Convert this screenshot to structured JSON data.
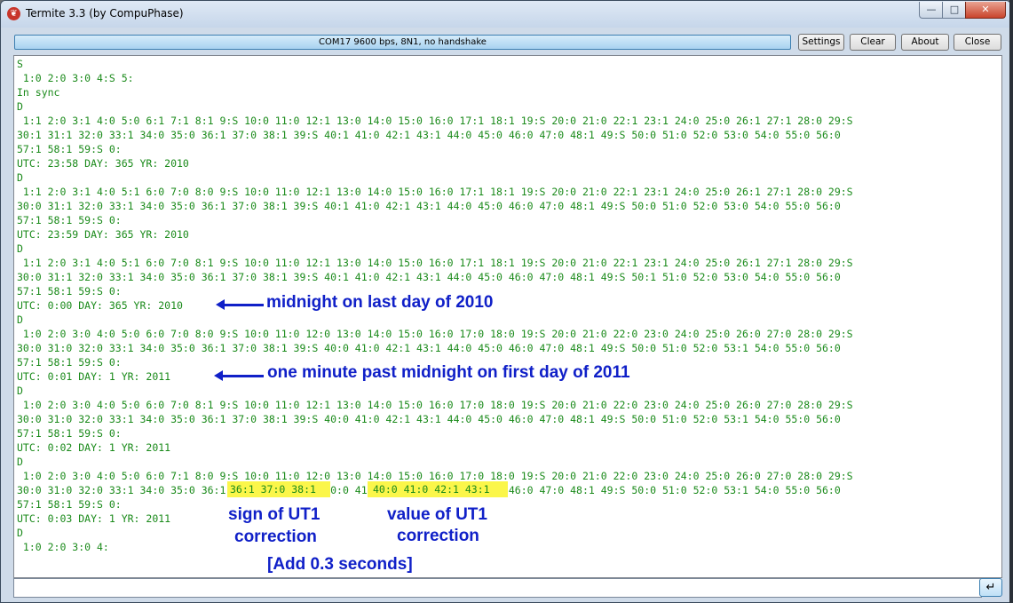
{
  "window": {
    "title": "Termite 3.3 (by CompuPhase)",
    "controls": {
      "minimize": "—",
      "maximize": "□",
      "close": "✕"
    }
  },
  "toolbar": {
    "status": "COM17 9600 bps, 8N1, no handshake",
    "settings": "Settings",
    "clear": "Clear",
    "about": "About",
    "close": "Close"
  },
  "terminal": {
    "lines": [
      "S",
      " 1:0 2:0 3:0 4:S 5:",
      "In sync",
      "D",
      " 1:1 2:0 3:1 4:0 5:0 6:1 7:1 8:1 9:S 10:0 11:0 12:1 13:0 14:0 15:0 16:0 17:1 18:1 19:S 20:0 21:0 22:1 23:1 24:0 25:0 26:1 27:1 28:0 29:S",
      "30:1 31:1 32:0 33:1 34:0 35:0 36:1 37:0 38:1 39:S 40:1 41:0 42:1 43:1 44:0 45:0 46:0 47:0 48:1 49:S 50:0 51:0 52:0 53:0 54:0 55:0 56:0",
      "57:1 58:1 59:S 0:",
      "UTC: 23:58 DAY: 365 YR: 2010",
      "D",
      " 1:1 2:0 3:1 4:0 5:1 6:0 7:0 8:0 9:S 10:0 11:0 12:1 13:0 14:0 15:0 16:0 17:1 18:1 19:S 20:0 21:0 22:1 23:1 24:0 25:0 26:1 27:1 28:0 29:S",
      "30:0 31:1 32:0 33:1 34:0 35:0 36:1 37:0 38:1 39:S 40:1 41:0 42:1 43:1 44:0 45:0 46:0 47:0 48:1 49:S 50:0 51:0 52:0 53:0 54:0 55:0 56:0",
      "57:1 58:1 59:S 0:",
      "UTC: 23:59 DAY: 365 YR: 2010",
      "D",
      " 1:1 2:0 3:1 4:0 5:1 6:0 7:0 8:1 9:S 10:0 11:0 12:1 13:0 14:0 15:0 16:0 17:1 18:1 19:S 20:0 21:0 22:1 23:1 24:0 25:0 26:1 27:1 28:0 29:S",
      "30:0 31:1 32:0 33:1 34:0 35:0 36:1 37:0 38:1 39:S 40:1 41:0 42:1 43:1 44:0 45:0 46:0 47:0 48:1 49:S 50:1 51:0 52:0 53:0 54:0 55:0 56:0",
      "57:1 58:1 59:S 0:",
      "UTC: 0:00 DAY: 365 YR: 2010",
      "D",
      " 1:0 2:0 3:0 4:0 5:0 6:0 7:0 8:0 9:S 10:0 11:0 12:0 13:0 14:0 15:0 16:0 17:0 18:0 19:S 20:0 21:0 22:0 23:0 24:0 25:0 26:0 27:0 28:0 29:S",
      "30:0 31:0 32:0 33:1 34:0 35:0 36:1 37:0 38:1 39:S 40:0 41:0 42:1 43:1 44:0 45:0 46:0 47:0 48:1 49:S 50:0 51:0 52:0 53:1 54:0 55:0 56:0",
      "57:1 58:1 59:S 0:",
      "UTC: 0:01 DAY: 1 YR: 2011",
      "D",
      " 1:0 2:0 3:0 4:0 5:0 6:0 7:0 8:1 9:S 10:0 11:0 12:1 13:0 14:0 15:0 16:0 17:0 18:0 19:S 20:0 21:0 22:0 23:0 24:0 25:0 26:0 27:0 28:0 29:S",
      "30:0 31:0 32:0 33:1 34:0 35:0 36:1 37:0 38:1 39:S 40:0 41:0 42:1 43:1 44:0 45:0 46:0 47:0 48:1 49:S 50:0 51:0 52:0 53:1 54:0 55:0 56:0",
      "57:1 58:1 59:S 0:",
      "UTC: 0:02 DAY: 1 YR: 2011",
      "D",
      " 1:0 2:0 3:0 4:0 5:0 6:0 7:1 8:0 9:S 10:0 11:0 12:0 13:0 14:0 15:0 16:0 17:0 18:0 19:S 20:0 21:0 22:0 23:0 24:0 25:0 26:0 27:0 28:0 29:S",
      "30:0 31:0 32:0 33:1 34:0 35:0 36:1 37:0 38:1 39:S 40:0 41:0 42:1 43:1 44:0 45:0 46:0 47:0 48:1 49:S 50:0 51:0 52:0 53:1 54:0 55:0 56:0",
      "57:1 58:1 59:S 0:",
      "UTC: 0:03 DAY: 1 YR: 2011",
      "D",
      " 1:0 2:0 3:0 4:"
    ],
    "highlights": {
      "sign": "36:1 37:0 38:1",
      "value": "40:0 41:0 42:1 43:1"
    }
  },
  "annotations": {
    "midnight_2010": "midnight on last day of 2010",
    "past_midnight_2011": "one minute past midnight on first day of 2011",
    "sign_line1": "sign of UT1",
    "sign_line2": "correction",
    "value_line1": "value of UT1",
    "value_line2": "correction",
    "add_seconds": "[Add 0.3 seconds]"
  },
  "input": {
    "value": "",
    "send_icon": "↵"
  },
  "colors": {
    "terminal_text": "#1a8a1a",
    "annotation": "#1020c8",
    "highlight": "#fbf64a"
  }
}
